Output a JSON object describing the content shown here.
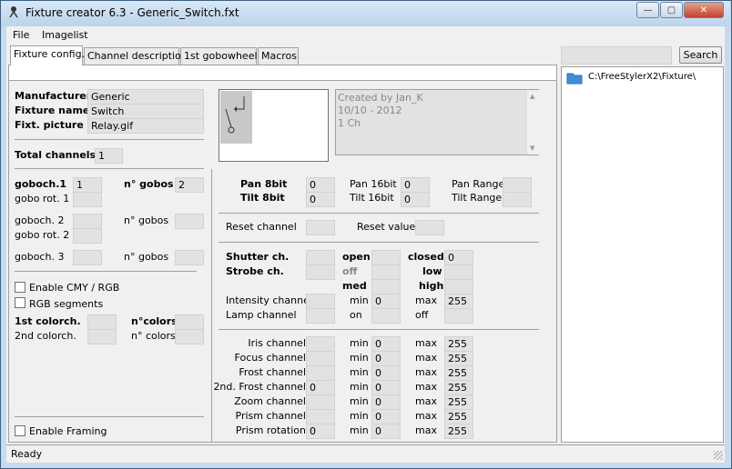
{
  "window": {
    "title": "Fixture creator 6.3 - Generic_Switch.fxt"
  },
  "menu": {
    "file": "File",
    "imagelist": "Imagelist"
  },
  "tabs": [
    "Fixture config.",
    "Channel description",
    "1st gobowheel",
    "Macros"
  ],
  "search": {
    "value": "",
    "button": "Search"
  },
  "tree": {
    "root": "C:\\FreeStylerX2\\Fixture\\"
  },
  "info": {
    "manufacturer_label": "Manufacturer",
    "manufacturer": "Generic",
    "name_label": "Fixture name",
    "name": "Switch",
    "picture_label": "Fixt. picture",
    "picture": "Relay.gif",
    "total_label": "Total channels",
    "total": "1"
  },
  "notes": {
    "line1": "Created by Jan_K",
    "line2": "10/10 - 2012",
    "line3": "1 Ch"
  },
  "gobo": {
    "goboch1": "goboch.1",
    "goboch1_val": "1",
    "ngobos1_label": "n° gobos",
    "ngobos1": "2",
    "gobo_rot1": "gobo rot. 1",
    "goboch2": "goboch. 2",
    "ngobos2_label": "n° gobos",
    "gobo_rot2": "gobo rot. 2",
    "goboch3": "goboch. 3",
    "ngobos3_label": "n° gobos"
  },
  "color": {
    "enable_cmy": "Enable CMY / RGB",
    "rgb_segments": "RGB segments",
    "colorch1": "1st colorch.",
    "ncolors1": "n°colors",
    "colorch2": "2nd colorch.",
    "ncolors2": "n° colors"
  },
  "framing": {
    "enable": "Enable Framing"
  },
  "pantilt": {
    "pan8": "Pan 8bit",
    "pan8_val": "0",
    "tilt8": "Tilt 8bit",
    "tilt8_val": "0",
    "pan16": "Pan 16bit",
    "pan16_val": "0",
    "tilt16": "Tilt 16bit",
    "tilt16_val": "0",
    "panrange": "Pan Range",
    "tiltrange": "Tilt Range"
  },
  "reset": {
    "channel": "Reset channel",
    "value": "Reset value"
  },
  "shutter": {
    "shutter": "Shutter ch.",
    "strobe": "Strobe ch.",
    "open": "open",
    "off": "off",
    "med": "med",
    "closed": "closed",
    "closed_val": "0",
    "low": "low",
    "high": "high"
  },
  "intensity": {
    "label": "Intensity channel",
    "min": "min",
    "min_val": "0",
    "max": "max",
    "max_val": "255"
  },
  "lamp": {
    "label": "Lamp channel",
    "on": "on",
    "off": "off"
  },
  "channels": [
    {
      "label": "Iris channel",
      "val": "",
      "min": "0",
      "max": "255"
    },
    {
      "label": "Focus channel",
      "val": "",
      "min": "0",
      "max": "255"
    },
    {
      "label": "Frost channel",
      "val": "",
      "min": "0",
      "max": "255"
    },
    {
      "label": "2nd. Frost channel",
      "val": "0",
      "min": "0",
      "max": "255"
    },
    {
      "label": "Zoom channel",
      "val": "",
      "min": "0",
      "max": "255"
    },
    {
      "label": "Prism channel",
      "val": "",
      "min": "0",
      "max": "255"
    },
    {
      "label": "Prism rotation",
      "val": "0",
      "min": "0",
      "max": "255"
    }
  ],
  "labels": {
    "min": "min",
    "max": "max"
  },
  "status": {
    "text": "Ready"
  }
}
